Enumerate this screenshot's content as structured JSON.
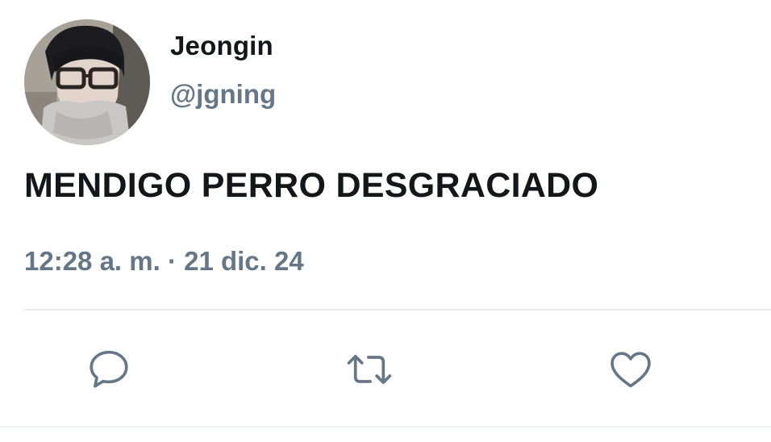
{
  "author": {
    "display_name": "Jeongin",
    "handle": "@jgning",
    "avatar_icon": "profile-photo"
  },
  "tweet": {
    "text": "MENDIGO PERRO DESGRACIADO",
    "timestamp": "12:28 a. m. · 21 dic. 24"
  },
  "actions": {
    "reply_icon": "comment-icon",
    "retweet_icon": "retweet-icon",
    "like_icon": "heart-icon"
  },
  "colors": {
    "text_primary": "#14171a",
    "text_secondary": "#657786",
    "icon": "#657786",
    "divider": "#e6ecf0",
    "background": "#ffffff"
  }
}
